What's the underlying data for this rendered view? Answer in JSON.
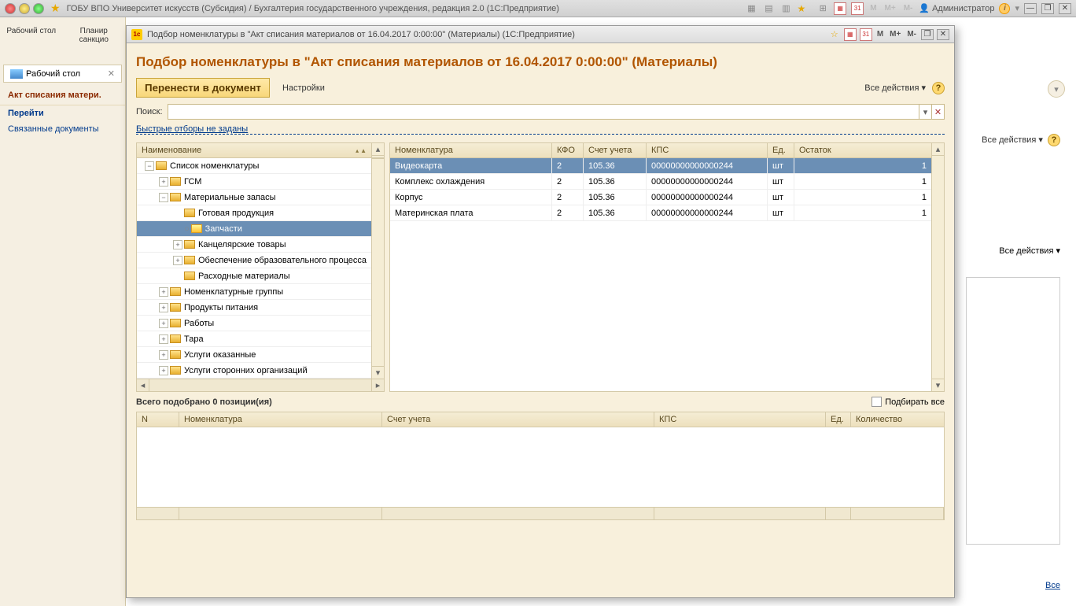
{
  "main": {
    "title": "ГОБУ ВПО Университет искусств (Субсидия) / Бухгалтерия государственного учреждения, редакция 2.0  (1С:Предприятие)",
    "admin": "Администратор",
    "m_buttons": [
      "M",
      "M+",
      "M-"
    ]
  },
  "sidebar": {
    "top_items": [
      "Рабочий стол",
      "Планир санкцио"
    ],
    "tab": "Рабочий стол",
    "section": "Акт списания матери.",
    "goto": "Перейти",
    "linked": "Связанные документы"
  },
  "bg": {
    "all_actions": "Все действия",
    "all": "Все"
  },
  "modal": {
    "titlebar": "Подбор номенклатуры в \"Акт списания материалов от 16.04.2017 0:00:00\"  (Материалы)  (1С:Предприятие)",
    "heading": "Подбор номенклатуры в \"Акт списания материалов от 16.04.2017 0:00:00\"  (Материалы)",
    "transfer_btn": "Перенести в документ",
    "settings": "Настройки",
    "all_actions": "Все действия",
    "search_label": "Поиск:",
    "filters_link": "Быстрые отборы не заданы",
    "m_buttons": [
      "M",
      "M+",
      "M-"
    ]
  },
  "tree": {
    "header": "Наименование",
    "items": [
      {
        "indent": 0,
        "exp": "−",
        "label": "Список номенклатуры"
      },
      {
        "indent": 1,
        "exp": "+",
        "label": "ГСМ"
      },
      {
        "indent": 1,
        "exp": "−",
        "label": "Материальные запасы"
      },
      {
        "indent": 2,
        "exp": "",
        "label": "Готовая продукция"
      },
      {
        "indent": 2,
        "exp": "○",
        "label": "Запчасти",
        "selected": true
      },
      {
        "indent": 2,
        "exp": "+",
        "label": "Канцелярские товары"
      },
      {
        "indent": 2,
        "exp": "+",
        "label": "Обеспечение образовательного процесса"
      },
      {
        "indent": 2,
        "exp": "",
        "label": "Расходные материалы"
      },
      {
        "indent": 1,
        "exp": "+",
        "label": "Номенклатурные группы"
      },
      {
        "indent": 1,
        "exp": "+",
        "label": "Продукты питания"
      },
      {
        "indent": 1,
        "exp": "+",
        "label": "Работы"
      },
      {
        "indent": 1,
        "exp": "+",
        "label": "Тара"
      },
      {
        "indent": 1,
        "exp": "+",
        "label": "Услуги оказанные"
      },
      {
        "indent": 1,
        "exp": "+",
        "label": "Услуги сторонних организаций"
      }
    ]
  },
  "grid": {
    "headers": {
      "nom": "Номенклатура",
      "kfo": "КФО",
      "schet": "Счет учета",
      "kps": "КПС",
      "ed": "Ед.",
      "ost": "Остаток"
    },
    "rows": [
      {
        "nom": "Видеокарта",
        "kfo": "2",
        "schet": "105.36",
        "kps": "00000000000000244",
        "ed": "шт",
        "ost": "1",
        "selected": true
      },
      {
        "nom": "Комплекс охлаждения",
        "kfo": "2",
        "schet": "105.36",
        "kps": "00000000000000244",
        "ed": "шт",
        "ost": "1"
      },
      {
        "nom": "Корпус",
        "kfo": "2",
        "schet": "105.36",
        "kps": "00000000000000244",
        "ed": "шт",
        "ost": "1"
      },
      {
        "nom": "Материнская плата",
        "kfo": "2",
        "schet": "105.36",
        "kps": "00000000000000244",
        "ed": "шт",
        "ost": "1"
      }
    ]
  },
  "summary": {
    "text": "Всего подобрано 0 позиции(ия)",
    "select_all": "Подбирать все"
  },
  "bottom_grid": {
    "headers": {
      "n": "N",
      "nom": "Номенклатура",
      "schet": "Счет учета",
      "kps": "КПС",
      "ed": "Ед.",
      "kol": "Количество"
    }
  }
}
